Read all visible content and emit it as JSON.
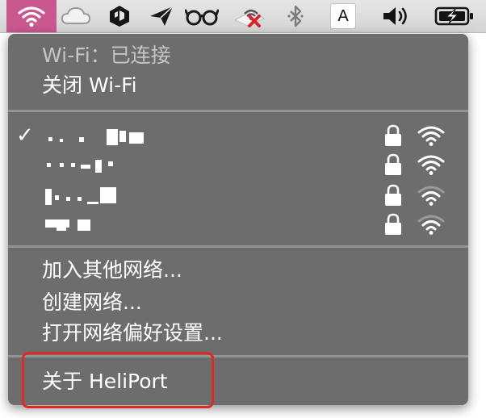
{
  "menubar": {
    "icons": [
      "wifi-icon",
      "cloud-icon",
      "box-app-icon",
      "paper-plane-icon",
      "glasses-icon",
      "wifi-disabled-icon",
      "bluetooth-icon",
      "input-source-icon",
      "volume-icon",
      "battery-charging-icon"
    ],
    "input_source_letter": "A",
    "wifi_highlight_color": "#c9588f"
  },
  "menu": {
    "status": "Wi-Fi：已连接",
    "toggle": "关闭 Wi-Fi",
    "networks": [
      {
        "connected": true,
        "secured": true,
        "signal_bars": 4,
        "name_obscured": true
      },
      {
        "connected": false,
        "secured": true,
        "signal_bars": 4,
        "name_obscured": true
      },
      {
        "connected": false,
        "secured": true,
        "signal_bars": 3,
        "name_obscured": true
      },
      {
        "connected": false,
        "secured": true,
        "signal_bars": 3,
        "name_obscured": true
      }
    ],
    "join_other": "加入其他网络...",
    "create_network": "创建网络...",
    "open_prefs": "打开网络偏好设置...",
    "about": "关于 HeliPort",
    "check_mark": "✓"
  },
  "highlight_color": "#dd2a24"
}
